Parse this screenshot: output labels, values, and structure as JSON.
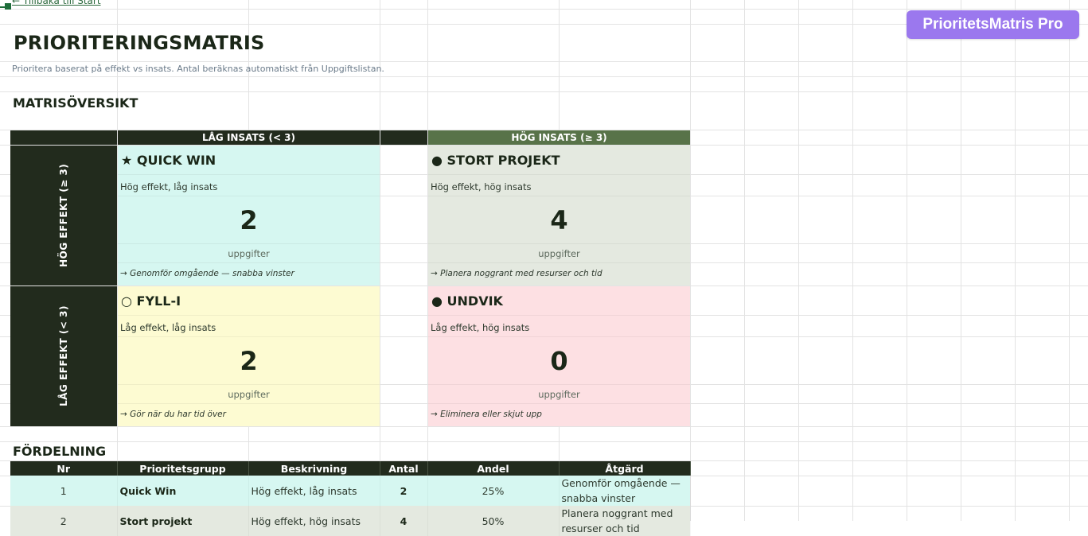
{
  "nav": {
    "back_link": "← Tillbaka till Start"
  },
  "brand": {
    "badge": "PrioritetsMatris Pro",
    "badge_color": "#9b78ee"
  },
  "page": {
    "title": "PRIORITERINGSMATRIS",
    "subtitle": "Prioritera baserat på effekt vs insats. Antal beräknas automatiskt från Uppgiftslistan."
  },
  "overview": {
    "heading": "MATRISÖVERSIKT",
    "col_headers": [
      "LÅG INSATS (< 3)",
      "HÖG INSATS (≥ 3)"
    ],
    "row_headers": [
      "HÖG EFFEKT (≥ 3)",
      "LÅG EFFEKT (< 3)"
    ],
    "quadrants": [
      {
        "title": "★ QUICK WIN",
        "desc": "Hög effekt, låg insats",
        "count": "2",
        "unit": "uppgifter",
        "action": "→ Genomför omgående — snabba vinster",
        "color": "#d6f7f1"
      },
      {
        "title": "● STORT PROJEKT",
        "desc": "Hög effekt, hög insats",
        "count": "4",
        "unit": "uppgifter",
        "action": "→ Planera noggrant med resurser och tid",
        "color": "#e4e9e0"
      },
      {
        "title": "○ FYLL-I",
        "desc": "Låg effekt, låg insats",
        "count": "2",
        "unit": "uppgifter",
        "action": "→ Gör när du har tid över",
        "color": "#fdfbd2"
      },
      {
        "title": "● UNDVIK",
        "desc": "Låg effekt, hög insats",
        "count": "0",
        "unit": "uppgifter",
        "action": "→ Eliminera eller skjut upp",
        "color": "#fde0e3"
      }
    ]
  },
  "distribution": {
    "heading": "FÖRDELNING",
    "columns": [
      "Nr",
      "Prioritetsgrupp",
      "Beskrivning",
      "Antal",
      "Andel",
      "Åtgärd"
    ],
    "rows": [
      {
        "nr": "1",
        "group": "Quick Win",
        "desc": "Hög effekt, låg insats",
        "count": "2",
        "share": "25%",
        "action": "Genomför omgående — snabba vinster"
      },
      {
        "nr": "2",
        "group": "Stort projekt",
        "desc": "Hög effekt, hög insats",
        "count": "4",
        "share": "50%",
        "action": "Planera noggrant med resurser och tid"
      }
    ]
  }
}
